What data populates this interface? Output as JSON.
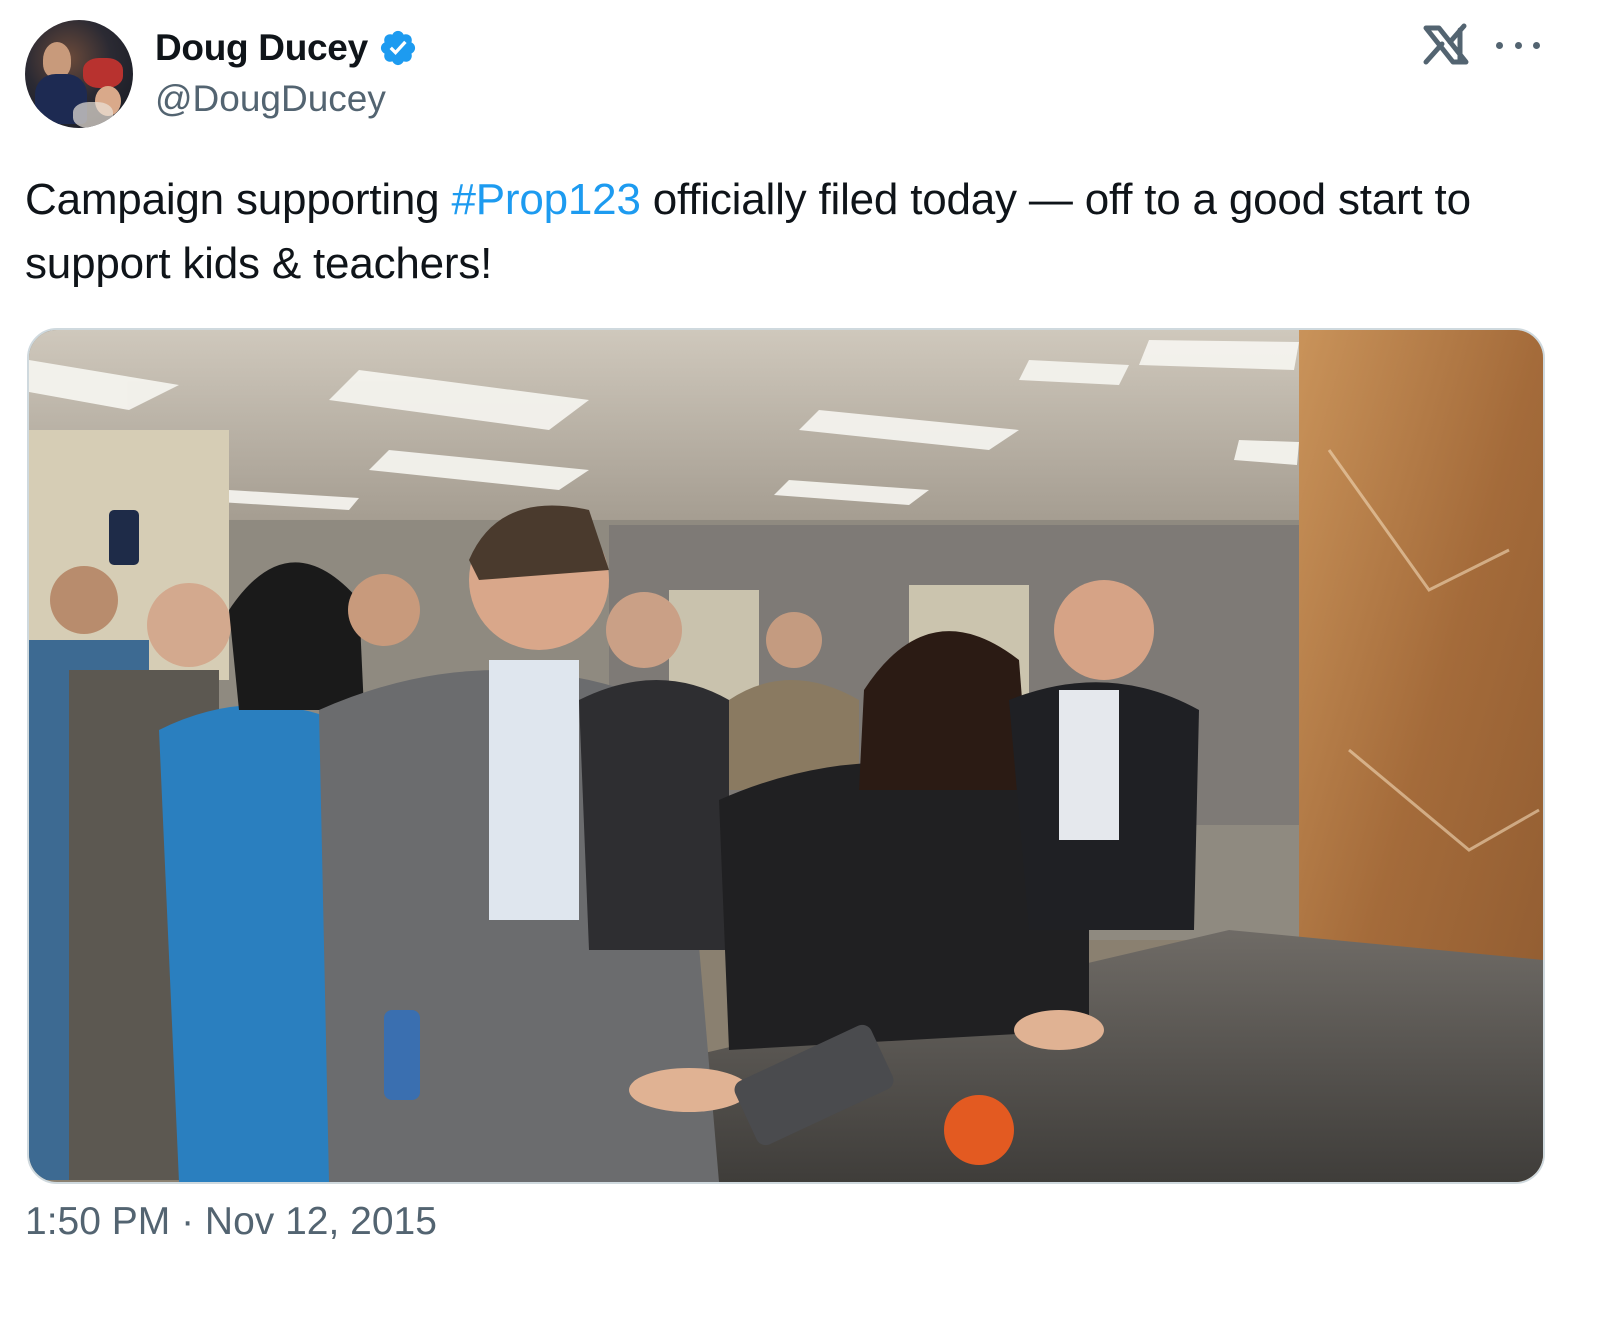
{
  "author": {
    "display_name": "Doug Ducey",
    "handle": "@DougDucey",
    "verified": true,
    "avatar_icon": "profile-photo"
  },
  "header_icons": {
    "logo": "x-logo-icon",
    "menu": "more-options-icon"
  },
  "tweet": {
    "text_before": "Campaign supporting ",
    "hashtag": "#Prop123",
    "text_after": " officially filed today — off to a good start to support kids & teachers!",
    "photo_alt": "photo",
    "timestamp": "1:50 PM · Nov 12, 2015"
  },
  "colors": {
    "link": "#1d9bf0",
    "secondary_text": "#536471",
    "primary_text": "#0f1419",
    "verified_badge": "#1d9bf0"
  }
}
